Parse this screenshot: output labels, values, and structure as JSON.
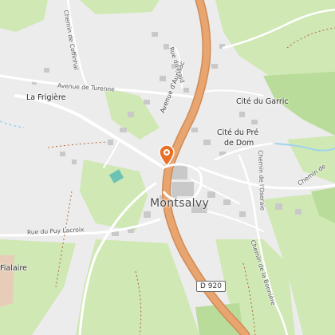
{
  "places": {
    "la_frigiere": "La Frigière",
    "cite_garric": "Cité du Garric",
    "cite_pre_dom_1": "Cité du Pré",
    "cite_pre_dom_2": "de Dom",
    "montsalvy": "Montsalvy",
    "fialaire": "Fialaire"
  },
  "roads": {
    "avenue_aurillac": "Avenue d'Aurillac",
    "avenue_turenne": "Avenue de Turenne",
    "chemin_coffinhal": "Chemin de Coffinhal",
    "rue_fraid": "Rue du Fraid",
    "chemin_oseraie": "Chemin de l'Oseraie",
    "chemin_bonniere": "Chemin de la Bonnière",
    "chemin_de": "Chemin de",
    "rue_puy_lacroix": "Rue du Puy Lacroix"
  },
  "route_shield": "D 920",
  "colors": {
    "background": "#ececec",
    "meadow": "#cfe8b4",
    "forest": "#b9dc9a",
    "main_road": "#e8a56f",
    "road_casing": "#d08a55",
    "street": "#ffffff",
    "building": "#c9c9c9",
    "water": "#9fd3ec",
    "marker": "#e8702a"
  },
  "marker_icon": "map-pin-icon"
}
